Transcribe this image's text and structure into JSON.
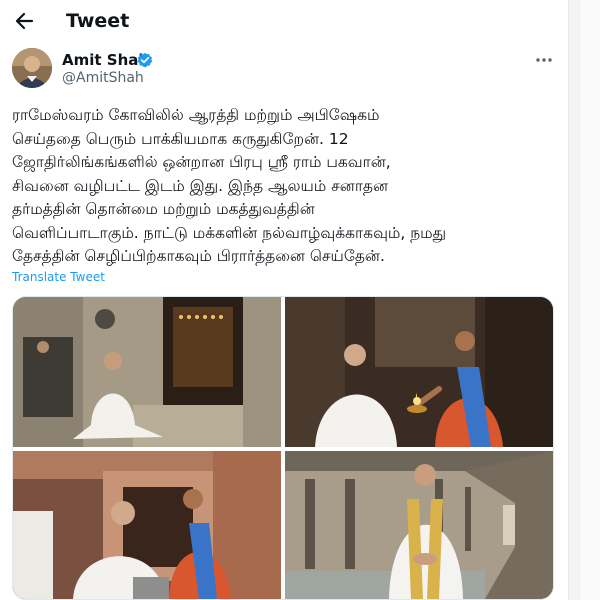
{
  "header": {
    "title": "Tweet",
    "back_icon": "arrow-left-icon"
  },
  "author": {
    "name": "Amit Shah",
    "handle": "@AmitShah",
    "verified": true,
    "badge_color": "#1d9bf0"
  },
  "tweet": {
    "lines": [
      "ராமேஸ்வரம் கோவிலில் ஆரத்தி மற்றும் அபிஷேகம்",
      "செய்ததை பெரும் பாக்கியமாக கருதுகிறேன். 12",
      "ஜோதிர்லிங்கங்களில் ஒன்றான பிரபு ஸ்ரீ ராம் பகவான்,",
      "சிவனை வழிபட்ட இடம் இது. இந்த ஆலயம் சனாதன",
      "தர்மத்தின் தொன்மை மற்றும் மகத்துவத்தின்",
      "வெளிப்பாடாகும். நாட்டு மக்களின் நல்வாழ்வுக்காகவும், நமது",
      "தேசத்தின் செழிப்பிற்காகவும் பிரார்த்தனை செய்தேன்."
    ],
    "translate_label": "Translate Tweet"
  },
  "media": {
    "photo_count": 4
  },
  "colors": {
    "text": "#0f1419",
    "secondary": "#536471",
    "link": "#1d9bf0"
  }
}
